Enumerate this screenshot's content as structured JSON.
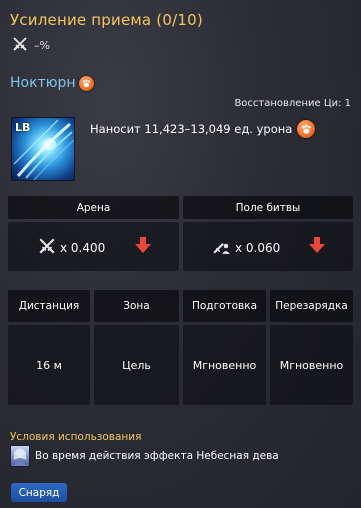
{
  "header": {
    "title": "Усиление приема (0/10)",
    "enhancement_value": "–%"
  },
  "skill": {
    "name": "Ноктюрн",
    "resource_text": "Восстановление Ци: 1",
    "icon_label": "LB",
    "damage_text": "Наносит 11,423–13,049 ед. урона"
  },
  "pvp": {
    "arena_label": "Арена",
    "arena_value": "x 0.400",
    "battlefield_label": "Поле битвы",
    "battlefield_value": "x 0.060"
  },
  "stats": [
    {
      "label": "Дистанция",
      "value": "16 м"
    },
    {
      "label": "Зона",
      "value": "Цель"
    },
    {
      "label": "Подготовка",
      "value": "Мгновенно"
    },
    {
      "label": "Перезарядка",
      "value": "Мгновенно"
    }
  ],
  "conditions": {
    "title": "Условия использования",
    "text": "Во время действия эффекта Небесная дева"
  },
  "tag": {
    "label": "Снаряд"
  },
  "colors": {
    "title": "#f2c75c",
    "skill_name": "#7fc6e8",
    "arrow_down": "#e8473a",
    "tag": "#1f56ac"
  }
}
